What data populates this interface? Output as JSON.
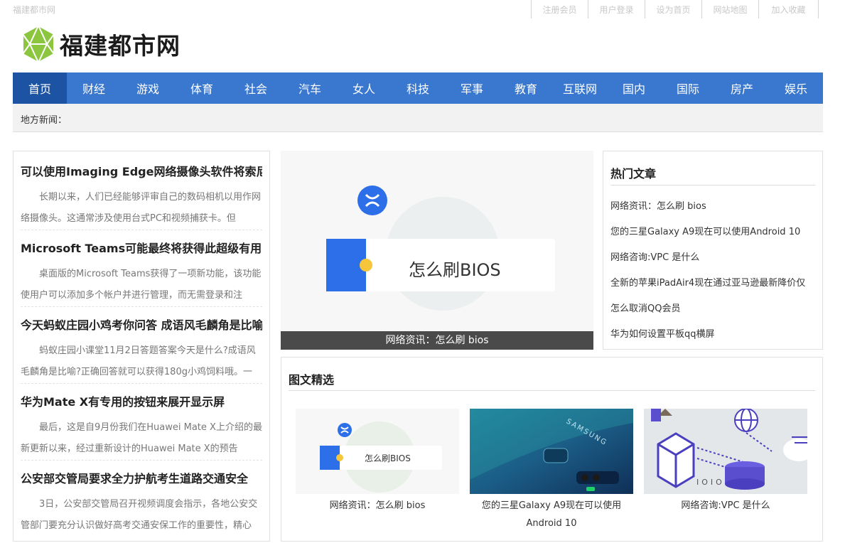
{
  "site": {
    "small_name": "福建都市网",
    "logo_text": "福建都市网"
  },
  "top_links": [
    "注册会员",
    "用户登录",
    "设为首页",
    "网站地图",
    "加入收藏"
  ],
  "nav": [
    "首页",
    "财经",
    "游戏",
    "体育",
    "社会",
    "汽车",
    "女人",
    "科技",
    "军事",
    "教育",
    "互联网",
    "国内",
    "国际",
    "房产",
    "娱乐"
  ],
  "local_news_label": "地方新闻：",
  "articles": [
    {
      "title": "可以使用Imaging Edge网络摄像头软件将索尼",
      "summary": "长期以来，人们已经能够评审自己的数码相机以用作网络摄像头。这通常涉及使用台式PC和视频捕获卡。但"
    },
    {
      "title": "Microsoft Teams可能最终将获得此超级有用的",
      "summary": "桌面版的Microsoft Teams获得了一项新功能，该功能使用户可以添加多个帐户并进行管理，而无需登录和注"
    },
    {
      "title": "今天蚂蚁庄园小鸡考你问答 成语风毛麟角是比喻",
      "summary": "蚂蚁庄园小课堂11月2日答题答案今天是什么?成语风毛麟角是比喻?正确回答就可以获得180g小鸡饲料哦。一"
    },
    {
      "title": "华为Mate X有专用的按钮来展开显示屏",
      "summary": "最后，这是自9月份我们在Huawei Mate X上介绍的最新更新以来，经过重新设计的Huawei Mate X的预告"
    },
    {
      "title": "公安部交管局要求全力护航考生道路交通安全",
      "summary": "3日，公安部交管局召开视频调度会指示，各地公安交管部门要充分认识做好高考交通安保工作的重要性，精心"
    }
  ],
  "feature": {
    "image_text": "怎么刷BIOS",
    "caption": "网络资讯：怎么刷 bios"
  },
  "hot": {
    "title": "热门文章",
    "items": [
      "网络资讯：怎么刷 bios",
      "您的三星Galaxy A9现在可以使用Android 10",
      "网络咨询:VPC 是什么",
      "全新的苹果iPadAir4现在通过亚马逊最新降价仅",
      "怎么取消QQ会员",
      "华为如何设置平板qq横屏"
    ]
  },
  "picks": {
    "title": "图文精选",
    "items": [
      {
        "caption": "网络资讯：怎么刷 bios",
        "image_text": "怎么刷BIOS"
      },
      {
        "caption": "您的三星Galaxy A9现在可以使用Android 10",
        "image_text": "SAMSUNG"
      },
      {
        "caption": "网络咨询:VPC 是什么",
        "image_text": "IOIO"
      }
    ]
  },
  "colors": {
    "nav": "#3a78cf",
    "nav_active": "#1c54a3",
    "caption_bar": "#4a4a4a",
    "bios_blue": "#2d6fe8",
    "bios_yellow": "#f5c53b"
  }
}
